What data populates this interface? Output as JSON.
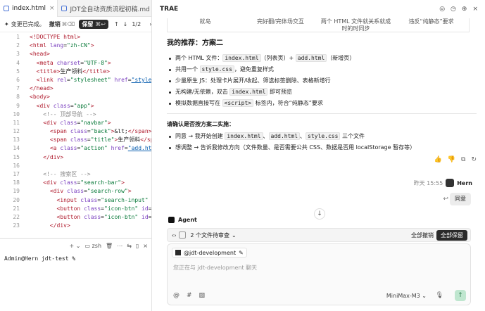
{
  "editor": {
    "tabs": [
      {
        "label": "index.html",
        "close": "×"
      },
      {
        "label": "JDT全自动资质流程初稿.md"
      }
    ],
    "action_bar": {
      "changes": "变更已完成。",
      "undo": "撤销",
      "undo_key": "⌘⌫",
      "keep": "保留",
      "keep_key": "⌘↩",
      "pager": "1/2"
    },
    "code_lines": [
      {
        "n": "1",
        "html": "<span class=\"tg\">&lt;!DOCTYPE html&gt;</span>"
      },
      {
        "n": "2",
        "html": "<span class=\"tg\">&lt;html</span> <span class=\"at\">lang</span>=<span class=\"st\">\"zh-CN\"</span><span class=\"tg\">&gt;</span>"
      },
      {
        "n": "3",
        "html": "<span class=\"tg\">&lt;head&gt;</span>"
      },
      {
        "n": "4",
        "html": "  <span class=\"tg\">&lt;meta</span> <span class=\"at\">charset</span>=<span class=\"st\">\"UTF-8\"</span><span class=\"tg\">&gt;</span>"
      },
      {
        "n": "5",
        "html": "  <span class=\"tg\">&lt;title&gt;</span><span class=\"tx\">生产领料</span><span class=\"tg\">&lt;/title&gt;</span>"
      },
      {
        "n": "6",
        "html": "  <span class=\"tg\">&lt;link</span> <span class=\"at\">rel</span>=<span class=\"st\">\"stylesheet\"</span> <span class=\"at\">href</span>=<span class=\"ul\">\"style.cs</span>"
      },
      {
        "n": "7",
        "html": "<span class=\"tg\">&lt;/head&gt;</span>"
      },
      {
        "n": "8",
        "html": "<span class=\"tg\">&lt;body&gt;</span>"
      },
      {
        "n": "9",
        "html": "  <span class=\"tg\">&lt;div</span> <span class=\"at\">class</span>=<span class=\"st\">\"app\"</span><span class=\"tg\">&gt;</span>"
      },
      {
        "n": "10",
        "html": "    <span class=\"cm\">&lt;!-- 顶部导航 --&gt;</span>"
      },
      {
        "n": "11",
        "html": "    <span class=\"tg\">&lt;div</span> <span class=\"at\">class</span>=<span class=\"st\">\"navbar\"</span><span class=\"tg\">&gt;</span>"
      },
      {
        "n": "12",
        "html": "      <span class=\"tg\">&lt;span</span> <span class=\"at\">class</span>=<span class=\"st\">\"back\"</span><span class=\"tg\">&gt;</span><span class=\"tx\">&amp;lt;</span><span class=\"tg\">&lt;/span&gt;</span>"
      },
      {
        "n": "13",
        "html": "      <span class=\"tg\">&lt;span</span> <span class=\"at\">class</span>=<span class=\"st\">\"title\"</span><span class=\"tg\">&gt;</span><span class=\"tx\">生产领料</span><span class=\"tg\">&lt;/span</span>"
      },
      {
        "n": "14",
        "html": "      <span class=\"tg\">&lt;a</span> <span class=\"at\">class</span>=<span class=\"st\">\"action\"</span> <span class=\"at\">href</span>=<span class=\"ul\">\"add.html'</span>"
      },
      {
        "n": "15",
        "html": "    <span class=\"tg\">&lt;/div&gt;</span>"
      },
      {
        "n": "16",
        "html": ""
      },
      {
        "n": "17",
        "html": "    <span class=\"cm\">&lt;!-- 搜索区 --&gt;</span>"
      },
      {
        "n": "18",
        "html": "    <span class=\"tg\">&lt;div</span> <span class=\"at\">class</span>=<span class=\"st\">\"search-bar\"</span><span class=\"tg\">&gt;</span>"
      },
      {
        "n": "19",
        "html": "      <span class=\"tg\">&lt;div</span> <span class=\"at\">class</span>=<span class=\"st\">\"search-row\"</span><span class=\"tg\">&gt;</span>"
      },
      {
        "n": "20",
        "html": "        <span class=\"tg\">&lt;input</span> <span class=\"at\">class</span>=<span class=\"st\">\"search-input\"</span> <span class=\"at\">typ</span>"
      },
      {
        "n": "21",
        "html": "        <span class=\"tg\">&lt;button</span> <span class=\"at\">class</span>=<span class=\"st\">\"icon-btn\"</span> <span class=\"at\">id</span>=<span class=\"st\">\"se</span>"
      },
      {
        "n": "22",
        "html": "        <span class=\"tg\">&lt;button</span> <span class=\"at\">class</span>=<span class=\"st\">\"icon-btn\"</span> <span class=\"at\">id</span>=<span class=\"st\">\"fi</span>"
      },
      {
        "n": "23",
        "html": "      <span class=\"tg\">&lt;/div&gt;</span>"
      }
    ]
  },
  "terminal": {
    "shell": "zsh",
    "prompt": "Admin@Hern jdt-test %"
  },
  "chat": {
    "title": "TRAE",
    "table_strip": [
      "就岛",
      "完好翻/完体场交互",
      "两个 HTML 文件就关系就成时的时同步",
      "违反“纯静态”要求"
    ],
    "recommend_title": "我的推荐：方案二",
    "rec_items": [
      {
        "pre": "两个 HTML 文件：",
        "c1": "index.html",
        "mid": "（列表页）+ ",
        "c2": "add.html",
        "post": "（新增页）"
      },
      {
        "pre": "共用一个 ",
        "c1": "style.css",
        "mid": "，避免重复样式",
        "c2": "",
        "post": ""
      },
      {
        "pre": "少量原生 JS：处理卡片展开/收起、筛选标签删除、表格新增行",
        "c1": "",
        "mid": "",
        "c2": "",
        "post": ""
      },
      {
        "pre": "无构建/无依赖，双击 ",
        "c1": "index.html",
        "mid": " 即可预览",
        "c2": "",
        "post": ""
      },
      {
        "pre": "模拟数据直接写在 ",
        "c1": "<script>",
        "mid": " 标签内，符合“纯静态”要求",
        "c2": "",
        "post": ""
      }
    ],
    "confirm_text": "请确认是否按方案二实施：",
    "confirm_items": [
      {
        "pre": "同意 → 我开始创建 ",
        "c1": "index.html",
        "s1": "、",
        "c2": "add.html",
        "s2": "、",
        "c3": "style.css",
        "post": " 三个文件"
      },
      {
        "pre": "想调整 → 告诉我修改方向（文件数量、是否需要公共 CSS、数据是否用 localStorage 暂存等）",
        "c1": "",
        "s1": "",
        "c2": "",
        "s2": "",
        "c3": "",
        "post": ""
      }
    ],
    "user": {
      "time": "昨天 15:55",
      "name": "Hern",
      "message": "同意"
    },
    "agent_label": "Agent",
    "review": {
      "count": "2 个文件待审查",
      "undo_all": "全部撤销",
      "keep_all": "全部保留"
    },
    "input": {
      "context": "@jdt-development",
      "placeholder": "您正在与 jdt-development 聊天",
      "model": "MiniMax-M3"
    }
  }
}
